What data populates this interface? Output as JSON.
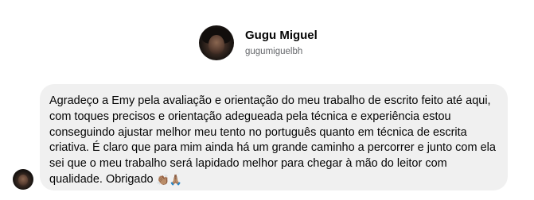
{
  "profile": {
    "name": "Gugu Miguel",
    "handle": "gugumiguelbh"
  },
  "message": {
    "text": "Agradeço a Emy pela avaliação e orientação do meu trabalho de escrito feito até aqui, com toques precisos e orientação adegueada pela técnica e experiência estou conseguindo ajustar melhor meu tento no português quanto em técnica de escrita criativa. É claro que para mim ainda há um grande caminho a percorrer e junto com ela sei que o meu trabalho será lapidado melhor para chegar à mão do leitor com qualidade. Obrigado",
    "emojis": [
      "👏🏽",
      "🙏🏽"
    ]
  }
}
